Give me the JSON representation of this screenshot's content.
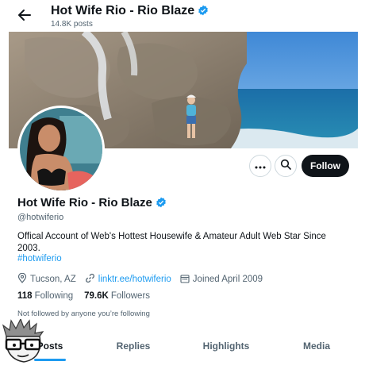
{
  "header": {
    "name": "Hot Wife Rio - Rio Blaze",
    "posts": "14.8K posts"
  },
  "profile": {
    "name": "Hot Wife Rio - Rio Blaze",
    "handle": "@hotwiferio",
    "bio": "Offical Account of Web's Hottest Housewife & Amateur Adult Web Star Since 2003.",
    "hashtag": "#hotwiferio",
    "location": "Tucson, AZ",
    "link": "linktr.ee/hotwiferio",
    "joined": "Joined April 2009",
    "following_count": "118",
    "following_label": "Following",
    "followers_count": "79.6K",
    "followers_label": "Followers",
    "not_followed": "Not followed by anyone you’re following"
  },
  "actions": {
    "follow_label": "Follow"
  },
  "tabs": [
    {
      "label": "Posts"
    },
    {
      "label": "Replies"
    },
    {
      "label": "Highlights"
    },
    {
      "label": "Media"
    }
  ],
  "colors": {
    "accent": "#1d9bf0",
    "text": "#0f1419",
    "muted": "#536471"
  },
  "icons": [
    "back-arrow-icon",
    "verified-badge-icon",
    "more-icon",
    "search-icon",
    "location-icon",
    "link-icon",
    "calendar-icon"
  ]
}
